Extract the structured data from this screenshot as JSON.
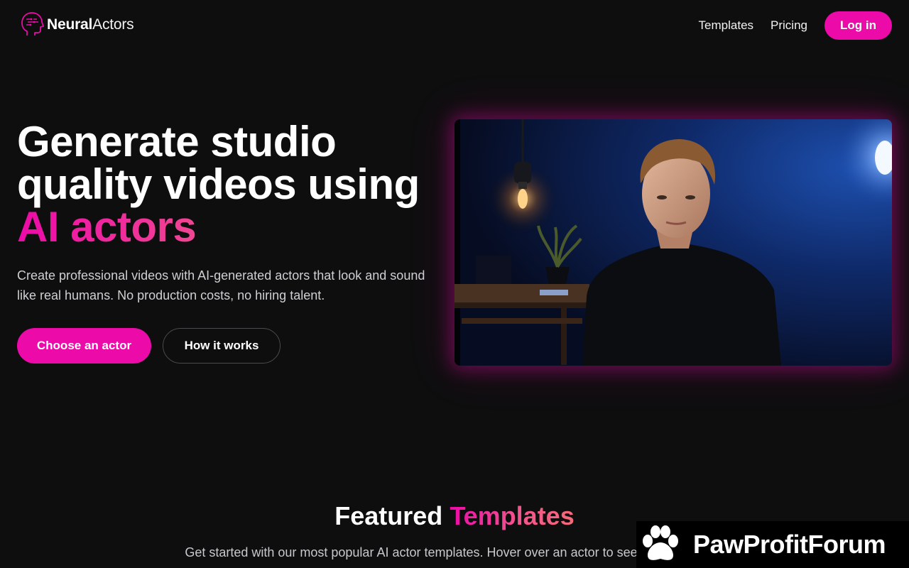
{
  "brand": {
    "name_bold": "Neural",
    "name_light": "Actors",
    "accent": "#ec0aa8"
  },
  "nav": {
    "links": [
      "Templates",
      "Pricing"
    ],
    "login_label": "Log in"
  },
  "hero": {
    "title_line1": "Generate studio",
    "title_line2": "quality videos using",
    "title_accent": "AI actors",
    "subtitle": "Create professional videos with AI-generated actors that look and sound like real humans. No production costs, no hiring talent.",
    "primary_cta": "Choose an actor",
    "secondary_cta": "How it works"
  },
  "featured": {
    "title_plain": "Featured",
    "title_accent": "Templates",
    "subtitle": "Get started with our most popular AI actor templates. Hover over an actor to see them in action."
  },
  "watermark": {
    "text": "PawProfitForum"
  }
}
